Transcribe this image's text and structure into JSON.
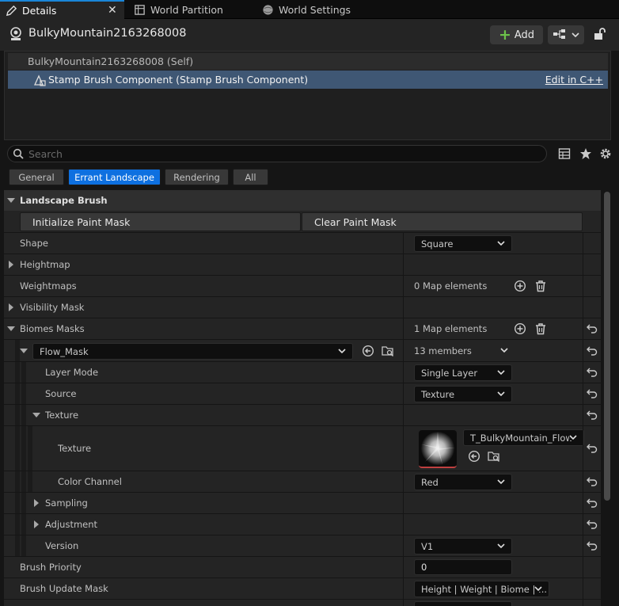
{
  "tabs": [
    {
      "label": "Details",
      "icon": "pencil-icon",
      "active": true
    },
    {
      "label": "World Partition",
      "icon": "map-icon",
      "active": false
    },
    {
      "label": "World Settings",
      "icon": "globe-icon",
      "active": false
    }
  ],
  "actor": {
    "name": "BulkyMountain2163268008",
    "add_label": "Add"
  },
  "components": {
    "self_label": "BulkyMountain2163268008 (Self)",
    "selected_label": "Stamp Brush Component (Stamp Brush Component)",
    "edit_link": "Edit in C++"
  },
  "search": {
    "placeholder": "Search",
    "value": ""
  },
  "filters": [
    "General",
    "Errant Landscape",
    "Rendering",
    "All"
  ],
  "props": {
    "category": "Landscape Brush",
    "init_mask_btn": "Initialize Paint Mask",
    "clear_mask_btn": "Clear Paint Mask",
    "shape_label": "Shape",
    "shape_value": "Square",
    "heightmap_label": "Heightmap",
    "weightmaps_label": "Weightmaps",
    "weightmaps_value": "0 Map elements",
    "visibility_label": "Visibility Mask",
    "biomes_label": "Biomes Masks",
    "biomes_value": "1 Map elements",
    "flow_key": "Flow_Mask",
    "flow_members": "13 members",
    "layer_mode_label": "Layer Mode",
    "layer_mode_value": "Single Layer",
    "source_label": "Source",
    "source_value": "Texture",
    "texture_group_label": "Texture",
    "texture_label": "Texture",
    "texture_value": "T_BulkyMountain_Flow",
    "color_channel_label": "Color Channel",
    "color_channel_value": "Red",
    "sampling_label": "Sampling",
    "adjustment_label": "Adjustment",
    "version_label": "Version",
    "version_value": "V1",
    "priority_label": "Brush Priority",
    "priority_value": "0",
    "update_mask_label": "Brush Update Mask",
    "update_mask_value": "Height | Weight | Biome | ..."
  }
}
